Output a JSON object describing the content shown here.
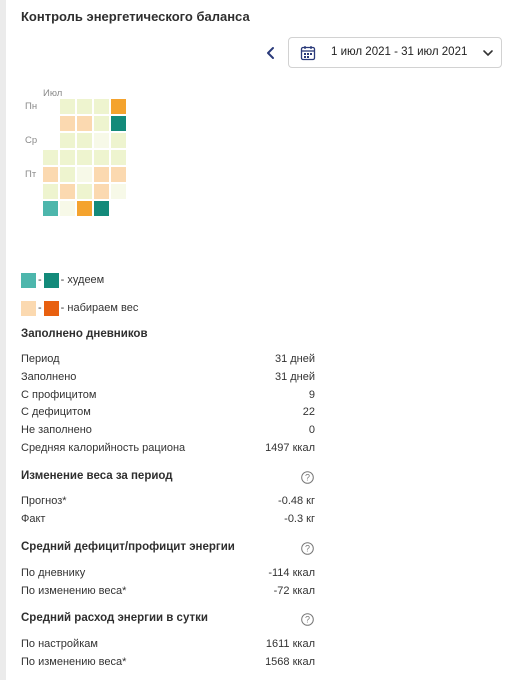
{
  "header": {
    "title": "Контроль энергетического баланса",
    "date_range": "1 июл 2021 - 31 июл 2021",
    "prev_icon": "chevron-left-icon"
  },
  "heatmap": {
    "month_label": "Июл",
    "day_labels": [
      "Пн",
      "Ср",
      "Пт"
    ],
    "colors": {
      "deficit_light": "#4db6ac",
      "deficit_dark": "#138a7a",
      "surplus_light": "#fbd9b0",
      "surplus_dark": "#e86010"
    }
  },
  "legend": {
    "lose": "- худеем",
    "gain": "- набираем вес"
  },
  "diaries": {
    "title": "Заполнено дневников",
    "rows": [
      {
        "label": "Период",
        "value": "31 дней"
      },
      {
        "label": "Заполнено",
        "value": "31 дней"
      },
      {
        "label": "С профицитом",
        "value": "9"
      },
      {
        "label": "С дефицитом",
        "value": "22"
      },
      {
        "label": "Не заполнено",
        "value": "0"
      },
      {
        "label": "Средняя калорийность рациона",
        "value": "1497 ккал"
      }
    ]
  },
  "weight_change": {
    "title": "Изменение веса за период",
    "rows": [
      {
        "label": "Прогноз*",
        "value": "-0.48 кг"
      },
      {
        "label": "Факт",
        "value": "-0.3 кг"
      }
    ]
  },
  "avg_balance": {
    "title": "Средний дефицит/профицит энергии",
    "rows": [
      {
        "label": "По дневнику",
        "value": "-114 ккал"
      },
      {
        "label": "По изменению веса*",
        "value": "-72 ккал"
      }
    ]
  },
  "avg_expense": {
    "title": "Средний расход энергии в сутки",
    "rows": [
      {
        "label": "По настройкам",
        "value": "1611 ккал"
      },
      {
        "label": "По изменению веса*",
        "value": "1568 ккал"
      }
    ]
  }
}
